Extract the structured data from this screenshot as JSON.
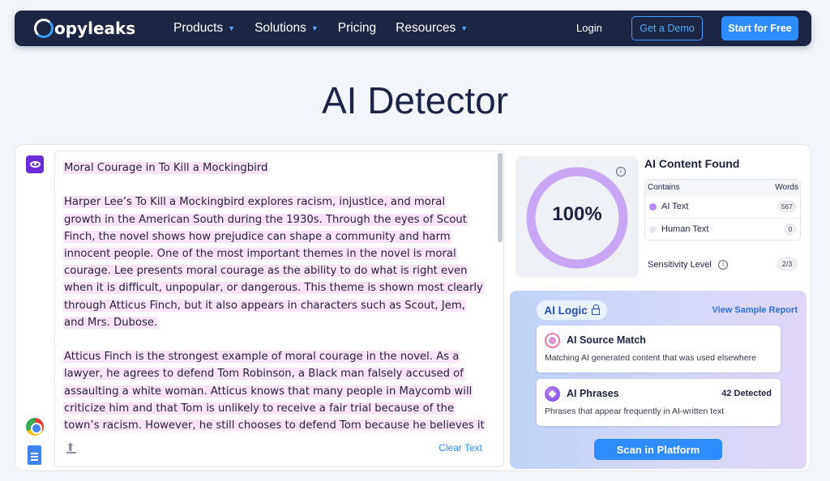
{
  "nav": {
    "logo": "opyleaks",
    "menu": [
      {
        "label": "Products",
        "has_caret": true
      },
      {
        "label": "Solutions",
        "has_caret": true
      },
      {
        "label": "Pricing",
        "has_caret": false
      },
      {
        "label": "Resources",
        "has_caret": true
      }
    ],
    "login": "Login",
    "demo": "Get a Demo",
    "free": "Start for Free"
  },
  "page_title": "AI Detector",
  "editor": {
    "title": "Moral Courage in To Kill a Mockingbird",
    "paragraphs": [
      "Harper Lee’s To Kill a Mockingbird explores racism, injustice, and moral growth in the American South during the 1930s. Through the eyes of Scout Finch, the novel shows how prejudice can shape a community and harm innocent people. One of the most important themes in the novel is moral courage. Lee presents moral courage as the ability to do what is right even when it is difficult, unpopular, or dangerous. This theme is shown most clearly through Atticus Finch, but it also appears in characters such as Scout, Jem, and Mrs. Dubose.",
      "Atticus Finch is the strongest example of moral courage in the novel. As a lawyer, he agrees to defend Tom Robinson, a Black man falsely accused of assaulting a white woman. Atticus knows that many people in Maycomb will criticize him and that Tom is unlikely to receive a fair trial because of the town’s racism. However, he still chooses to defend Tom because he believes it is the right thing to do. Atticus teaches his children that a person must follow their conscience, even when society"
    ],
    "clear_label": "Clear Text"
  },
  "results": {
    "score": "100%",
    "score_fraction": 1.0,
    "found_title": "AI Content Found",
    "table": {
      "col_contains": "Contains",
      "col_words": "Words",
      "rows": [
        {
          "label": "AI Text",
          "count": "567"
        },
        {
          "label": "Human Text",
          "count": "0"
        }
      ]
    },
    "sensitivity_label": "Sensitivity Level",
    "sensitivity_value": "2/3"
  },
  "logic": {
    "label": "AI Logic",
    "sample_link": "View Sample Report",
    "source_match": {
      "title": "AI Source Match",
      "desc": "Matching AI generated content that was used elsewhere"
    },
    "phrases": {
      "title": "AI Phrases",
      "count": "42 Detected",
      "desc": "Phrases that appear frequently in AI-written text"
    },
    "scan_button": "Scan in Platform"
  },
  "colors": {
    "nav_bg": "#1c2541",
    "accent_blue": "#2f8cff",
    "ring_purple": "#c9a6f5",
    "highlight": "#fbe3fa"
  }
}
